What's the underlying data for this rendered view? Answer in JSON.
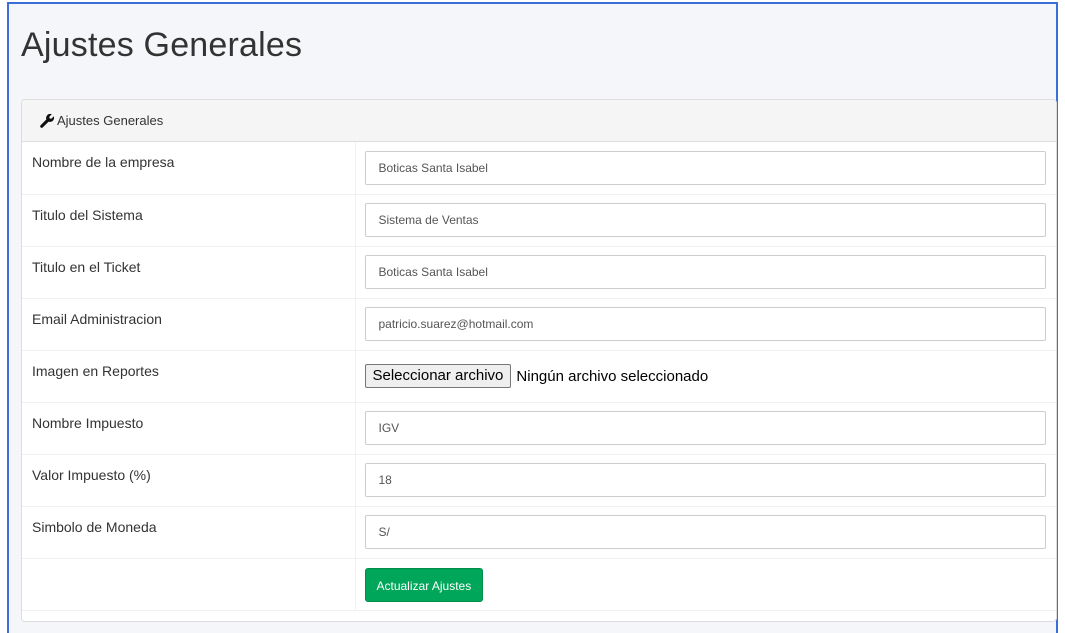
{
  "page": {
    "title": "Ajustes Generales"
  },
  "panel": {
    "heading": "Ajustes Generales",
    "heading_icon": "wrench-icon"
  },
  "form": {
    "fields": [
      {
        "label": "Nombre de la empresa",
        "value": "Boticas Santa Isabel"
      },
      {
        "label": "Titulo del Sistema",
        "value": "Sistema de Ventas"
      },
      {
        "label": "Titulo en el Ticket",
        "value": "Boticas Santa Isabel"
      },
      {
        "label": "Email Administracion",
        "value": "patricio.suarez@hotmail.com"
      },
      {
        "label": "Imagen en Reportes",
        "file_button": "Seleccionar archivo",
        "file_status": "Ningún archivo seleccionado"
      },
      {
        "label": "Nombre Impuesto",
        "value": "IGV"
      },
      {
        "label": "Valor Impuesto (%)",
        "value": "18"
      },
      {
        "label": "Simbolo de Moneda",
        "value": "S/"
      }
    ],
    "submit_label": "Actualizar Ajustes"
  },
  "colors": {
    "accent_border": "#3a6fd8",
    "submit_button": "#00a65a"
  }
}
